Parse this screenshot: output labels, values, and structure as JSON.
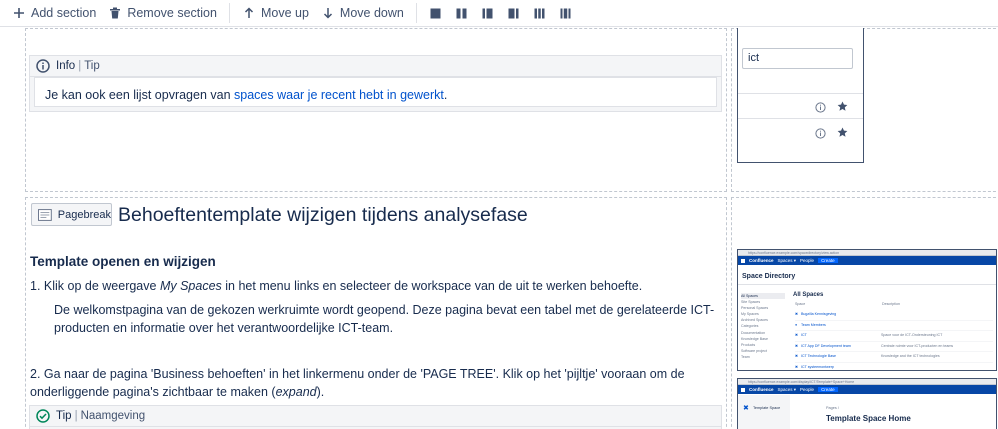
{
  "toolbar": {
    "add_section": "Add section",
    "remove_section": "Remove section",
    "move_up": "Move up",
    "move_down": "Move down"
  },
  "info_macro": {
    "title": "Info",
    "subtitle": "Tip",
    "body_before": "Je kan ook een lijst opvragen van ",
    "body_link": "spaces waar je recent hebt in gewerkt",
    "body_after": "."
  },
  "thumb1": {
    "search_value": "ict"
  },
  "pagebreak": {
    "label": "Pagebreak"
  },
  "heading": "Behoeftentemplate wijzigen tijdens analysefase",
  "subheading": "Template openen en wijzigen",
  "step1": {
    "before": "1. Klik op de weergave ",
    "em": "My Spaces",
    "after": " in het menu links en selecteer de workspace van de uit te werken behoefte."
  },
  "step1_note": "De welkomstpagina van de gekozen werkruimte wordt geopend. Deze pagina bevat een tabel met de gerelateerde ICT-producten en informatie over het verantwoordelijke ICT-team.",
  "step2": {
    "before": "2. Ga naar de pagina 'Business behoeften' in het linkermenu onder de 'PAGE TREE'. Klik op het 'pijltje' vooraan om de onderliggende pagina's zichtbaar te maken (",
    "em": "expand",
    "after": ")."
  },
  "tip_macro": {
    "title": "Tip",
    "subtitle": "Naamgeving"
  },
  "shot1": {
    "url": "https://confluence.example.com/spacedirectory/view.action",
    "brand": "Confluence",
    "nav_spaces": "Spaces ▾",
    "nav_people": "People",
    "nav_create": "Create",
    "title": "Space Directory",
    "side_items": [
      "All Spaces",
      "Site Spaces",
      "Personal Spaces",
      "My Spaces",
      "Archived Spaces",
      "Categories",
      "Documentation",
      "Knowledge Base",
      "Products",
      "Software project",
      "Team"
    ],
    "list_title": "All Spaces",
    "col_space": "Space",
    "col_desc": "Description",
    "rows": [
      {
        "name": "Bugzilla Kennisgeving",
        "desc": ""
      },
      {
        "name": "Team Members",
        "desc": ""
      },
      {
        "name": "ICT",
        "desc": "Space voor de ICT-Ondersteuning ICT"
      },
      {
        "name": "ICT App DF Development team",
        "desc": "Centrale ruimte voor ICT-producten en teams"
      },
      {
        "name": "ICT Technologie Base",
        "desc": "Knowledge and the ICT technologies"
      },
      {
        "name": "ICT systeemontwerp",
        "desc": ""
      }
    ]
  },
  "shot2": {
    "url": "https://confluence.example.com/display/ICT/Template+Space+Home",
    "brand": "Confluence",
    "nav_spaces": "Spaces ▾",
    "nav_people": "People",
    "nav_create": "Create",
    "sidebar_label": "Template Space",
    "crumb": "Pages  /",
    "title": "Template Space Home"
  },
  "colors": {
    "link": "#0052cc",
    "text": "#172b4d",
    "subtle": "#42526e",
    "info_icon": "#42526e",
    "tip_icon": "#00875a",
    "confluence_nav": "#0747a6"
  }
}
